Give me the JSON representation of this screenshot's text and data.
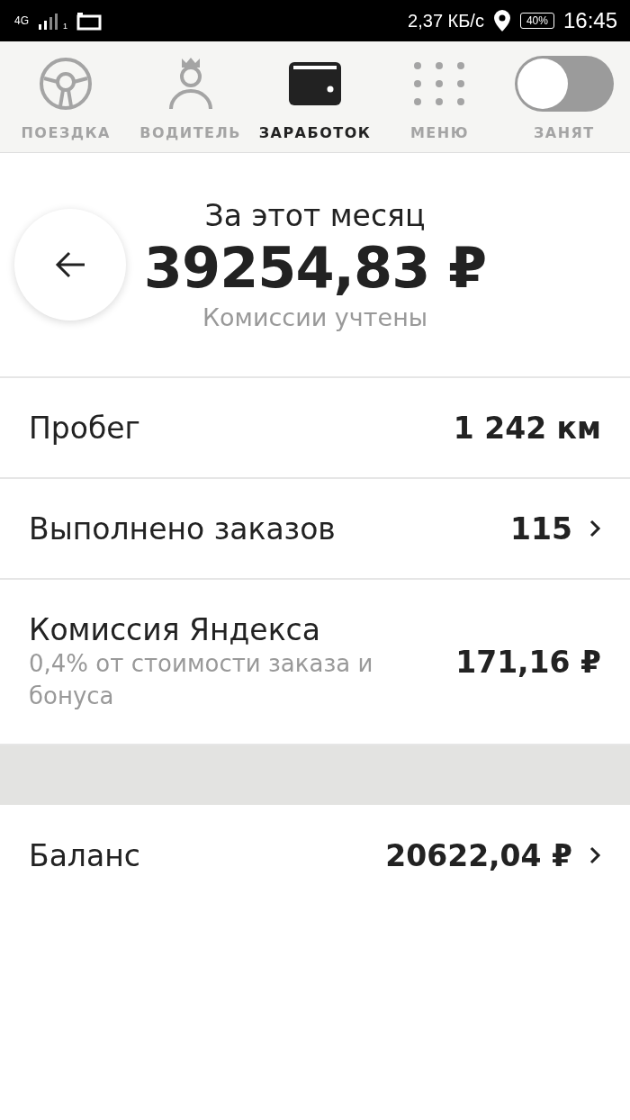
{
  "status_bar": {
    "network": "4G",
    "sim": "1",
    "speed": "2,37 КБ/с",
    "battery": "40%",
    "time": "16:45"
  },
  "tabs": [
    {
      "label": "ПОЕЗДКА",
      "selected": false
    },
    {
      "label": "ВОДИТЕЛЬ",
      "selected": false
    },
    {
      "label": "ЗАРАБОТОК",
      "selected": true
    },
    {
      "label": "МЕНЮ",
      "selected": false
    }
  ],
  "busy_toggle": {
    "label": "ЗАНЯТ",
    "on": false
  },
  "summary": {
    "title": "За этот месяц",
    "amount": "39254,83 ₽",
    "note": "Комиссии учтены"
  },
  "rows": [
    {
      "label": "Пробег",
      "value": "1 242 км",
      "chevron": false
    },
    {
      "label": "Выполнено заказов",
      "value": "115",
      "chevron": true
    },
    {
      "label": "Комиссия Яндекса",
      "sublabel": "0,4% от стоимости заказа и бонуса",
      "value": "171,16 ₽",
      "chevron": false
    }
  ],
  "balance": {
    "label": "Баланс",
    "value": "20622,04 ₽",
    "chevron": true
  }
}
